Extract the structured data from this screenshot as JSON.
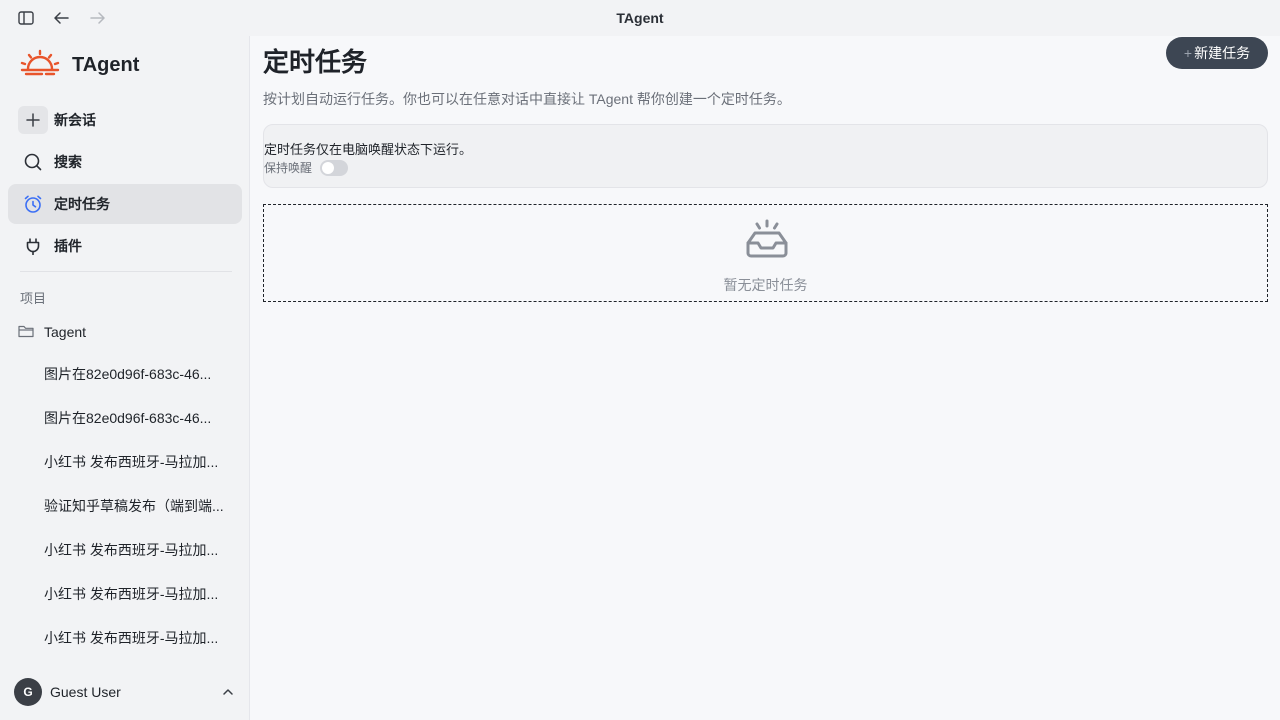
{
  "window": {
    "title": "TAgent"
  },
  "sidebar": {
    "brand": "TAgent",
    "nav": [
      {
        "label": "新会话",
        "icon": "plus-icon"
      },
      {
        "label": "搜索",
        "icon": "search-icon"
      },
      {
        "label": "定时任务",
        "icon": "clock-icon",
        "active": true
      },
      {
        "label": "插件",
        "icon": "plug-icon"
      }
    ],
    "section_label": "项目",
    "project": {
      "label": "Tagent",
      "icon": "folder-icon"
    },
    "conversations": [
      "图片在82e0d96f-683c-46...",
      "图片在82e0d96f-683c-46...",
      "小红书 发布西班牙-马拉加...",
      "验证知乎草稿发布（端到端...",
      "小红书 发布西班牙-马拉加...",
      "小红书 发布西班牙-马拉加...",
      "小红书 发布西班牙-马拉加..."
    ],
    "user": {
      "initial": "G",
      "name": "Guest User"
    }
  },
  "main": {
    "title": "定时任务",
    "new_button": "新建任务",
    "subtitle": "按计划自动运行任务。你也可以在任意对话中直接让 TAgent 帮你创建一个定时任务。",
    "notice": "定时任务仅在电脑唤醒状态下运行。",
    "keep_awake_label": "保持唤醒",
    "keep_awake_on": false,
    "empty_text": "暂无定时任务"
  },
  "colors": {
    "accent": "#3b6ff5",
    "brand_logo": "#e8542b",
    "button_dark": "#3d4653"
  }
}
